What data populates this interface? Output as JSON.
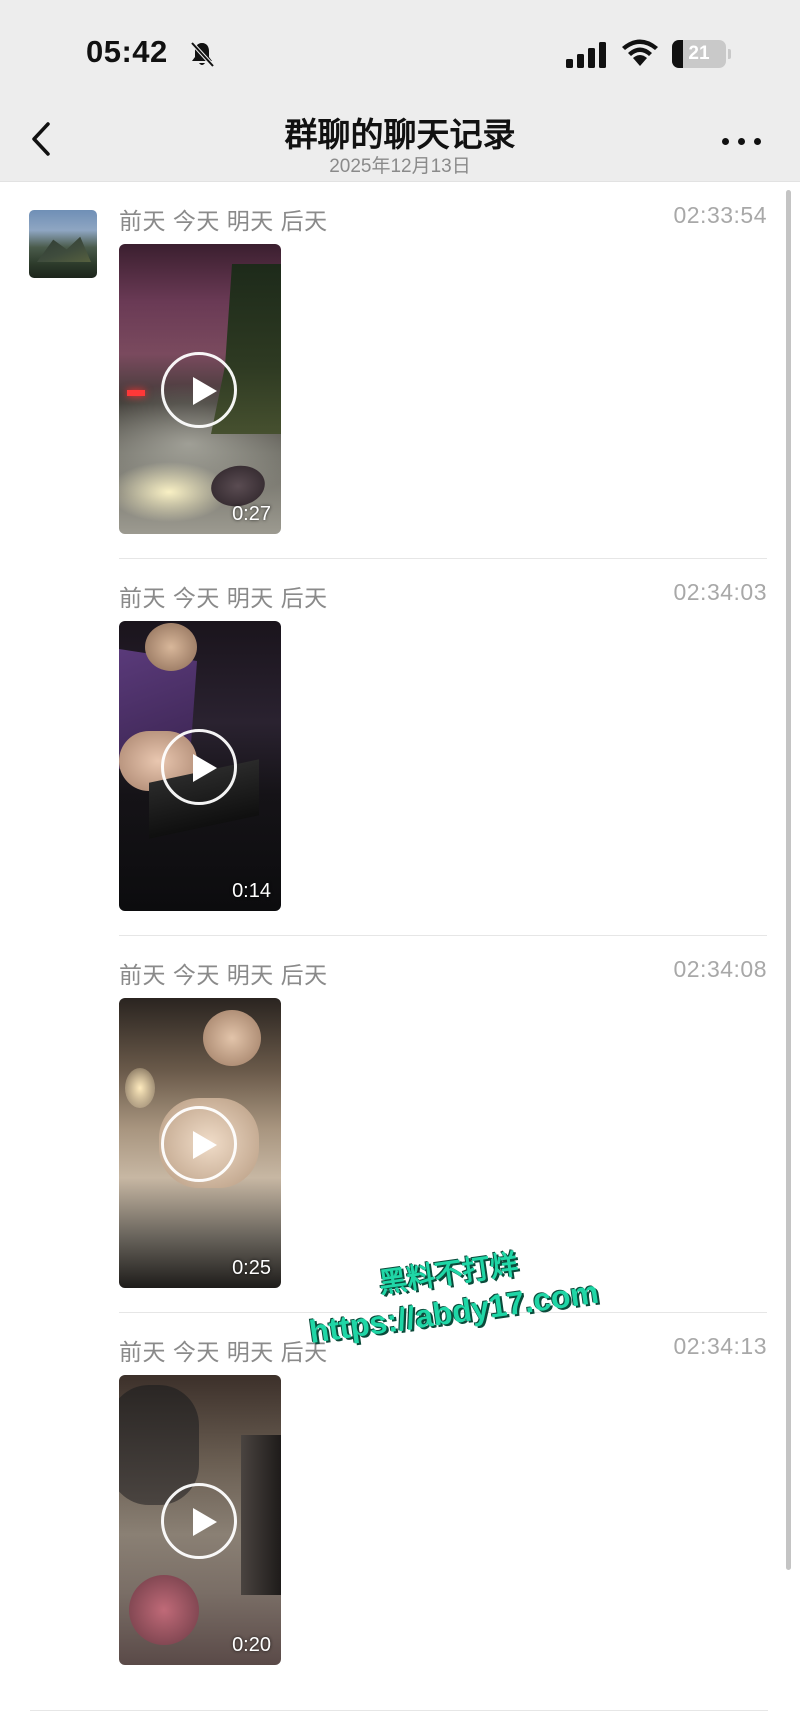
{
  "status_bar": {
    "time": "05:42",
    "battery": "21",
    "battery_level": 0.21,
    "icons": [
      "bell-muted-icon",
      "signal-icon",
      "wifi-icon",
      "battery-icon"
    ]
  },
  "nav": {
    "title": "群聊的聊天记录",
    "subtitle": "2025年12月13日",
    "back_icon": "chevron-left-icon",
    "more_icon": "ellipsis-icon"
  },
  "messages": [
    {
      "sender": "前天 今天 明天 后天",
      "time": "02:33:54",
      "duration": "0:27"
    },
    {
      "sender": "前天 今天 明天 后天",
      "time": "02:34:03",
      "duration": "0:14"
    },
    {
      "sender": "前天 今天 明天 后天",
      "time": "02:34:08",
      "duration": "0:25"
    },
    {
      "sender": "前天 今天 明天 后天",
      "time": "02:34:13",
      "duration": "0:20"
    }
  ],
  "watermark": {
    "line1": "黑料不打烊",
    "line2": "https://abdy17.com"
  },
  "colors": {
    "header_bg": "#ededed",
    "watermark": "#1fd6a6"
  }
}
